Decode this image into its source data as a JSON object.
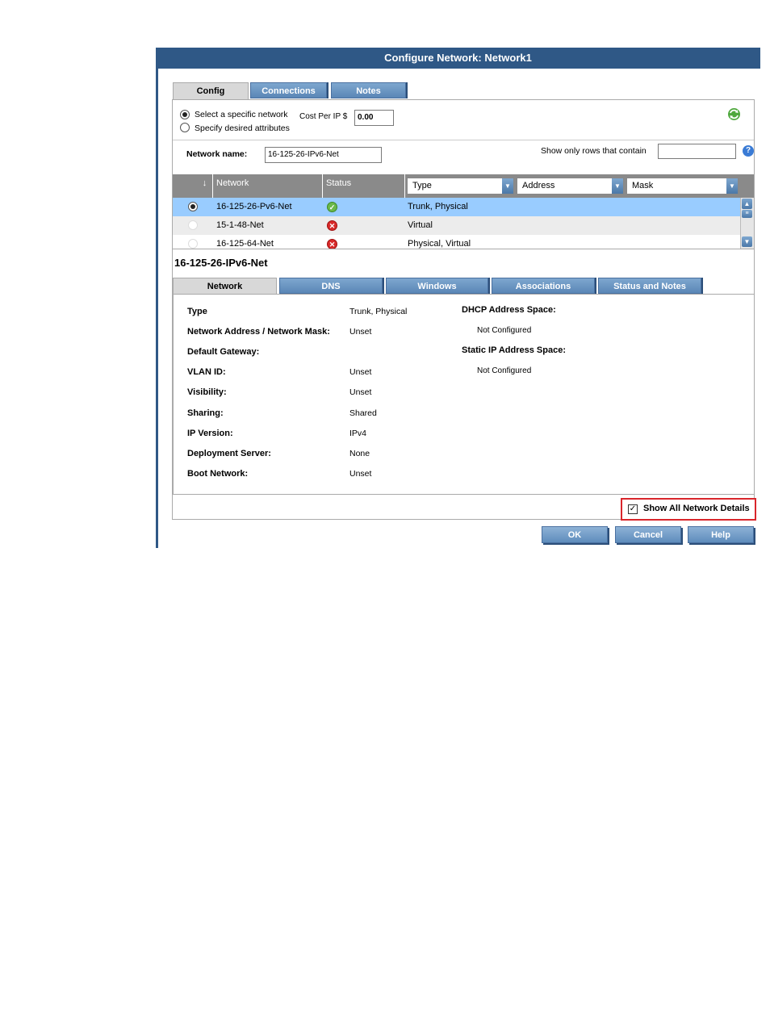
{
  "window": {
    "title": "Configure Network: Network1"
  },
  "main_tabs": [
    {
      "label": "Config",
      "active": true
    },
    {
      "label": "Connections",
      "active": false
    },
    {
      "label": "Notes",
      "active": false
    }
  ],
  "selection": {
    "option_specific": "Select a specific network",
    "option_attributes": "Specify desired attributes",
    "selected": "specific",
    "cost_label": "Cost Per IP $",
    "cost_value": "0.00",
    "refresh_icon": "refresh-icon"
  },
  "filter": {
    "name_label": "Network name:",
    "name_value": "16-125-26-IPv6-Net",
    "show_rows_label": "Show only rows that contain",
    "show_rows_value": "",
    "help_icon": "help-icon"
  },
  "grid": {
    "columns": {
      "network": "Network",
      "status": "Status",
      "type": "Type",
      "address": "Address",
      "mask": "Mask"
    },
    "rows": [
      {
        "name": "16-125-26-Pv6-Net",
        "status": "ok",
        "type": "Trunk, Physical",
        "selected": true
      },
      {
        "name": "15-1-48-Net",
        "status": "error",
        "type": "Virtual",
        "selected": false
      },
      {
        "name": "16-125-64-Net",
        "status": "error",
        "type": "Physical, Virtual",
        "selected": false
      }
    ]
  },
  "detail": {
    "title": "16-125-26-IPv6-Net",
    "tabs": [
      {
        "label": "Network",
        "active": true
      },
      {
        "label": "DNS",
        "active": false
      },
      {
        "label": "Windows",
        "active": false
      },
      {
        "label": "Associations",
        "active": false
      },
      {
        "label": "Status and Notes",
        "active": false
      }
    ],
    "fields": [
      {
        "label": "Type",
        "value": "Trunk, Physical"
      },
      {
        "label": "Network Address / Network Mask:",
        "value": "Unset"
      },
      {
        "label": "Default Gateway:",
        "value": ""
      },
      {
        "label": "VLAN ID:",
        "value": "Unset"
      },
      {
        "label": "Visibility:",
        "value": "Unset"
      },
      {
        "label": "Sharing:",
        "value": "Shared"
      },
      {
        "label": "IP Version:",
        "value": "IPv4"
      },
      {
        "label": "Deployment Server:",
        "value": "None"
      },
      {
        "label": "Boot Network:",
        "value": "Unset"
      }
    ],
    "dhcp_label": "DHCP Address Space:",
    "dhcp_value": "Not Configured",
    "static_label": "Static IP Address Space:",
    "static_value": "Not Configured"
  },
  "show_all": {
    "label": "Show All Network Details",
    "checked": true,
    "highlight_color": "#d9262c"
  },
  "buttons": {
    "ok": "OK",
    "cancel": "Cancel",
    "help": "Help"
  },
  "colors": {
    "title_bar": "#2f5886",
    "selected_row": "#99ccff",
    "tab_blue": "#6e98c4"
  }
}
